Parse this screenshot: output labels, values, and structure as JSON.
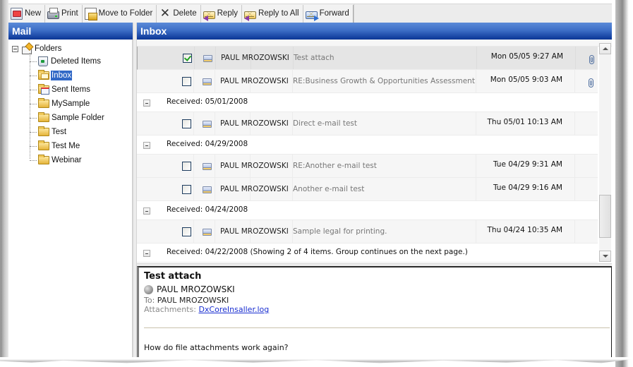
{
  "toolbar": {
    "buttons": [
      {
        "label": "New",
        "icon": "new-mail-icon"
      },
      {
        "label": "Print",
        "icon": "printer-icon"
      },
      {
        "label": "Move to Folder",
        "icon": "move-to-folder-icon"
      },
      {
        "label": "Delete",
        "icon": "delete-x-icon",
        "glyph": "✕"
      },
      {
        "label": "Reply",
        "icon": "reply-icon"
      },
      {
        "label": "Reply to All",
        "icon": "reply-all-icon"
      },
      {
        "label": "Forward",
        "icon": "forward-icon"
      }
    ]
  },
  "sidebar": {
    "title": "Mail",
    "root": {
      "label": "Folders",
      "expanded": true
    },
    "folders": [
      {
        "label": "Deleted Items",
        "icon": "deleted-items-icon"
      },
      {
        "label": "Inbox",
        "icon": "inbox-folder-icon",
        "selected": true
      },
      {
        "label": "Sent Items",
        "icon": "sent-items-folder-icon"
      },
      {
        "label": "MySample",
        "icon": "folder-icon"
      },
      {
        "label": "Sample Folder",
        "icon": "folder-icon"
      },
      {
        "label": "Test",
        "icon": "folder-icon"
      },
      {
        "label": "Test Me",
        "icon": "folder-icon"
      },
      {
        "label": "Webinar",
        "icon": "folder-icon"
      }
    ]
  },
  "inbox": {
    "title": "Inbox",
    "items": [
      {
        "type": "message",
        "checked": true,
        "selected": true,
        "from": "PAUL MROZOWSKI",
        "subject": "Test attach",
        "date": "Mon 05/05 9:27 AM",
        "attachment": true
      },
      {
        "type": "message",
        "checked": false,
        "from": "PAUL MROZOWSKI",
        "subject": "RE:Business Growth & Opportunities Assessment",
        "date": "Mon 05/05 9:03 AM",
        "attachment": true
      },
      {
        "type": "group",
        "label": "Received: 05/01/2008"
      },
      {
        "type": "message",
        "checked": false,
        "from": "PAUL MROZOWSKI",
        "subject": "Direct e-mail test",
        "date": "Thu 05/01 10:13 AM",
        "attachment": false
      },
      {
        "type": "group",
        "label": "Received: 04/29/2008"
      },
      {
        "type": "message",
        "checked": false,
        "from": "PAUL MROZOWSKI",
        "subject": "RE:Another e-mail test",
        "date": "Tue 04/29 9:31 AM",
        "attachment": false
      },
      {
        "type": "message",
        "checked": false,
        "from": "PAUL MROZOWSKI",
        "subject": "Another e-mail test",
        "date": "Tue 04/29 9:16 AM",
        "attachment": false
      },
      {
        "type": "group",
        "label": "Received: 04/24/2008"
      },
      {
        "type": "message",
        "checked": false,
        "from": "PAUL MROZOWSKI",
        "subject": "Sample legal for printing.",
        "date": "Thu 04/24 10:35 AM",
        "attachment": false
      },
      {
        "type": "group",
        "label": "Received: 04/22/2008 (Showing 2 of 4 items. Group continues on the next page.)"
      }
    ]
  },
  "preview": {
    "subject": "Test attach",
    "from": "PAUL MROZOWSKI",
    "to_label": "To:",
    "to": "PAUL MROZOWSKI",
    "attachments_label": "Attachments:",
    "attachment_name": "DxCoreInsaller.log",
    "body": "How do file attachments work again?"
  }
}
